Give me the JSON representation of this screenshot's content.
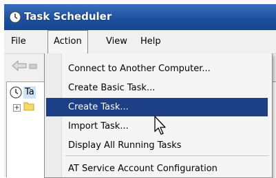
{
  "window": {
    "title": "Task Scheduler"
  },
  "menubar": {
    "items": [
      "File",
      "Action",
      "View",
      "Help"
    ],
    "open_item": "Action"
  },
  "tree": {
    "root_label": "Ta"
  },
  "action_menu": {
    "items": [
      "Connect to Another Computer...",
      "Create Basic Task...",
      "Create Task...",
      "Import Task...",
      "Display All Running Tasks",
      "AT Service Account Configuration"
    ],
    "highlighted": "Create Task..."
  },
  "colors": {
    "titlebar": "#1d4f9e",
    "highlight": "#1d3f85"
  }
}
